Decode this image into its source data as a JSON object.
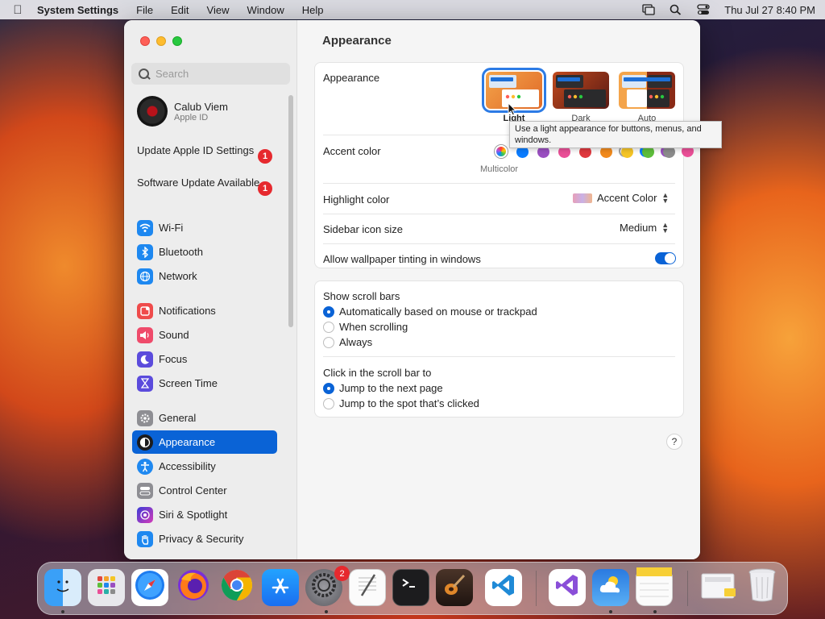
{
  "menubar": {
    "app_name": "System Settings",
    "menus": [
      "File",
      "Edit",
      "View",
      "Window",
      "Help"
    ],
    "clock": "Thu Jul 27  8:40 PM"
  },
  "sidebar": {
    "search_placeholder": "Search",
    "profile": {
      "name": "Calub Viem",
      "subtitle": "Apple ID"
    },
    "notices": [
      {
        "label": "Update Apple ID Settings",
        "badge": "1"
      },
      {
        "label": "Software Update Available",
        "badge": "1"
      }
    ],
    "items": [
      {
        "label": "Wi-Fi",
        "icon": "wifi-icon",
        "color": "#1e88f0"
      },
      {
        "label": "Bluetooth",
        "icon": "bluetooth-icon",
        "color": "#1e88f0"
      },
      {
        "label": "Network",
        "icon": "globe-icon",
        "color": "#1e88f0"
      },
      {
        "label": "Notifications",
        "icon": "bell-icon",
        "color": "#ef4b4b"
      },
      {
        "label": "Sound",
        "icon": "speaker-icon",
        "color": "#ef4b6b"
      },
      {
        "label": "Focus",
        "icon": "moon-icon",
        "color": "#5b4bdc"
      },
      {
        "label": "Screen Time",
        "icon": "hourglass-icon",
        "color": "#5b4bdc"
      },
      {
        "label": "General",
        "icon": "gear-icon",
        "color": "#8e8e93"
      },
      {
        "label": "Appearance",
        "icon": "appearance-icon",
        "color": "#1c1c1e",
        "active": true
      },
      {
        "label": "Accessibility",
        "icon": "accessibility-icon",
        "color": "#1e88f0"
      },
      {
        "label": "Control Center",
        "icon": "control-center-icon",
        "color": "#8e8e93"
      },
      {
        "label": "Siri & Spotlight",
        "icon": "siri-icon",
        "color": "#c043d6"
      },
      {
        "label": "Privacy & Security",
        "icon": "hand-icon",
        "color": "#1e88f0"
      }
    ]
  },
  "main": {
    "title": "Appearance",
    "appearance_label": "Appearance",
    "appearance_options": [
      {
        "label": "Light",
        "selected": true
      },
      {
        "label": "Dark",
        "selected": false
      },
      {
        "label": "Auto",
        "selected": false
      }
    ],
    "tooltip": "Use a light appearance for buttons, menus, and windows.",
    "accent_label": "Accent color",
    "accent_colors": [
      "multicolor",
      "#0a7cff",
      "#9a4fc1",
      "#ea4f97",
      "#e0383e",
      "#f18a1d",
      "#f5c526",
      "#5ebe3b",
      "#8c8c8c"
    ],
    "accent_selected_caption": "Multicolor",
    "highlight_label": "Highlight color",
    "highlight_value": "Accent Color",
    "icon_size_label": "Sidebar icon size",
    "icon_size_value": "Medium",
    "tinting_label": "Allow wallpaper tinting in windows",
    "tinting_on": true,
    "scroll_bars_label": "Show scroll bars",
    "scroll_bars_options": [
      {
        "label": "Automatically based on mouse or trackpad",
        "selected": true
      },
      {
        "label": "When scrolling",
        "selected": false
      },
      {
        "label": "Always",
        "selected": false
      }
    ],
    "click_label": "Click in the scroll bar to",
    "click_options": [
      {
        "label": "Jump to the next page",
        "selected": true
      },
      {
        "label": "Jump to the spot that’s clicked",
        "selected": false
      }
    ],
    "help": "?"
  },
  "dock": {
    "apps": [
      {
        "name": "finder",
        "icon": "finder-icon",
        "color": "#1e8ef5"
      },
      {
        "name": "launchpad",
        "icon": "launchpad-icon",
        "color": "#e8e8ec"
      },
      {
        "name": "safari",
        "icon": "compass-icon",
        "color": "#1e7df0"
      },
      {
        "name": "firefox",
        "icon": "firefox-icon",
        "color": "#7a2fd6"
      },
      {
        "name": "chrome",
        "icon": "chrome-icon",
        "color": "#ffffff"
      },
      {
        "name": "app-store",
        "icon": "app-store-icon",
        "color": "#1a8cf5"
      },
      {
        "name": "system-settings",
        "icon": "gear-icon",
        "color": "#7a7a80",
        "badge": "2"
      },
      {
        "name": "textedit",
        "icon": "pen-icon",
        "color": "#f4f4f4"
      },
      {
        "name": "terminal",
        "icon": "terminal-icon",
        "color": "#1c1c1e"
      },
      {
        "name": "garageband",
        "icon": "guitar-icon",
        "color": "#3a2a22"
      },
      {
        "name": "vscode",
        "icon": "vscode-icon",
        "color": "#ffffff"
      },
      {
        "name": "visual-studio",
        "icon": "visual-studio-icon",
        "color": "#ffffff"
      },
      {
        "name": "weather",
        "icon": "cloud-icon",
        "color": "#2a76d2"
      },
      {
        "name": "notes",
        "icon": "notes-icon",
        "color": "#fbfbfb"
      },
      {
        "name": "downloads",
        "icon": "folder-icon",
        "color": "#f0f0f0"
      },
      {
        "name": "trash",
        "icon": "trash-icon",
        "color": "#e6e6ea"
      }
    ]
  }
}
